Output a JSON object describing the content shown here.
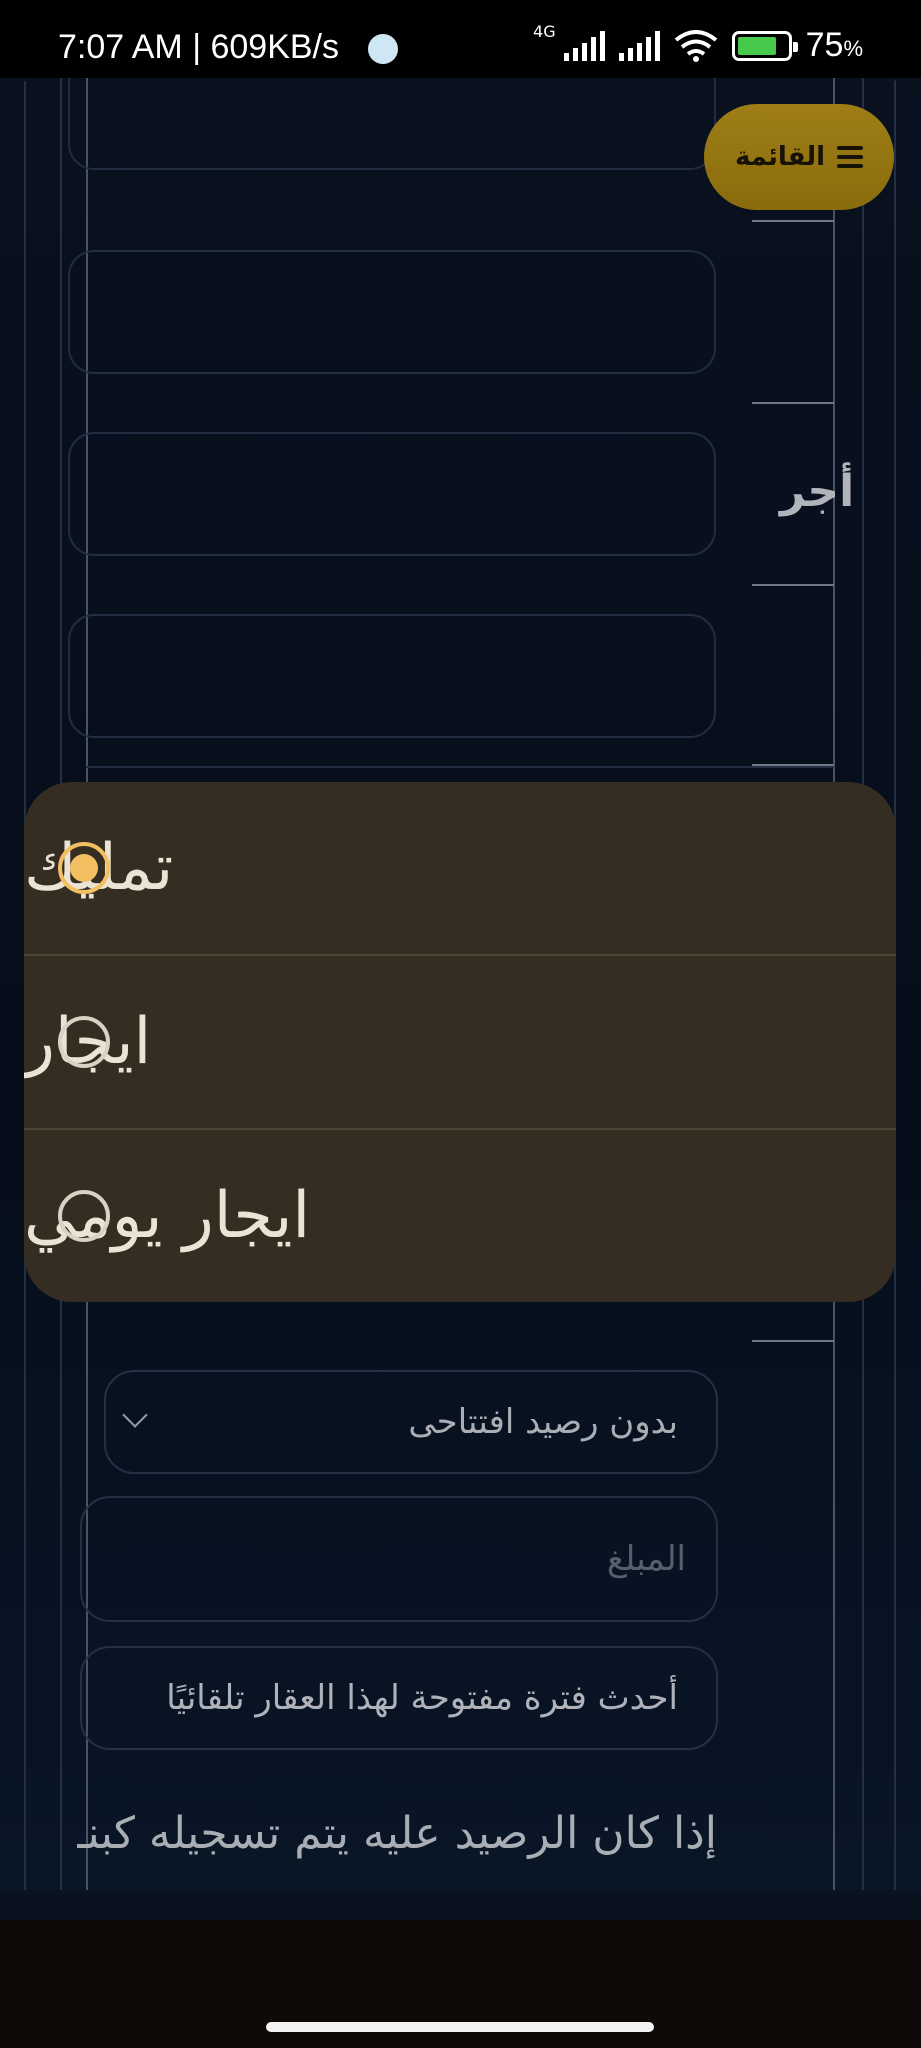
{
  "status_bar": {
    "time_speed": "7:07 AM | 609KB/s",
    "network": "4G",
    "battery": "75",
    "battery_unit": "%"
  },
  "header": {
    "menu_label": "القائمة",
    "side_label": "أجر"
  },
  "popup": {
    "options": [
      {
        "label": "تمليك",
        "checked": true
      },
      {
        "label": "ايجار",
        "checked": false
      },
      {
        "label": "ايجار يومي",
        "checked": false
      }
    ]
  },
  "form": {
    "opening_balance_select": "بدون رصيد افتتاحى",
    "amount_placeholder": "المبلغ",
    "auto_period_note": "أحدث فترة مفتوحة لهذا العقار تلقائيًا",
    "balance_note": "إذا كان الرصيد عليه يتم تسجيله كبنـ"
  },
  "colors": {
    "accent_gold": "#b8921a",
    "radio_selected": "#f2bf63",
    "popup_bg": "#352d21",
    "page_bg": "#0a1220"
  }
}
